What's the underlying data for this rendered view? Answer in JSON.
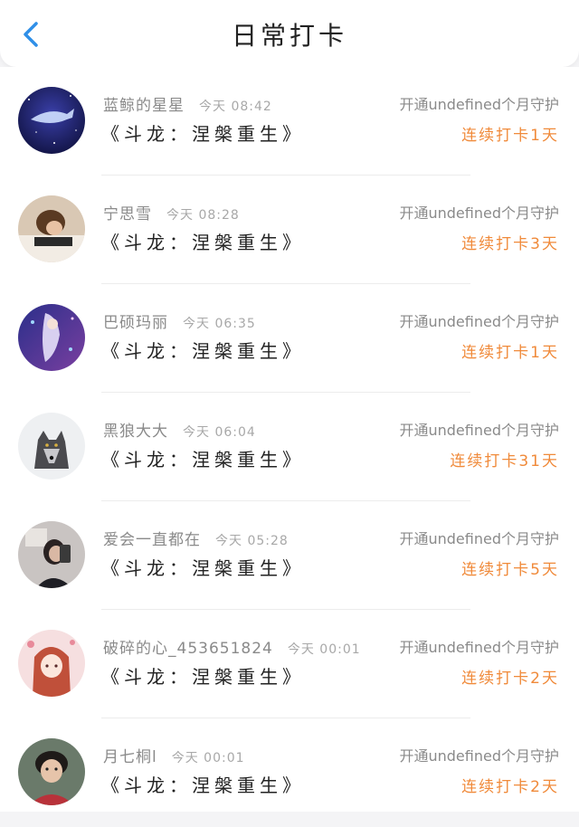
{
  "header": {
    "title": "日常打卡",
    "back_icon": "chevron-left-icon",
    "accent": "#2f8fe8"
  },
  "colors": {
    "streak": "#f08a3a",
    "muted": "#8a8a8a"
  },
  "entries": [
    {
      "username": "蓝鲸的星星",
      "time": "今天 08:42",
      "book": "《斗龙：涅槃重生》",
      "vip": "开通undefined个月守护",
      "streak": "连续打卡1天",
      "avatar": "whale-night-avatar"
    },
    {
      "username": "宁思雪",
      "time": "今天 08:28",
      "book": "《斗龙：涅槃重生》",
      "vip": "开通undefined个月守护",
      "streak": "连续打卡3天",
      "avatar": "girl-studying-avatar"
    },
    {
      "username": "巴硕玛丽",
      "time": "今天 06:35",
      "book": "《斗龙：涅槃重生》",
      "vip": "开通undefined个月守护",
      "streak": "连续打卡1天",
      "avatar": "anime-fantasy-avatar"
    },
    {
      "username": "黑狼大大",
      "time": "今天 06:04",
      "book": "《斗龙：涅槃重生》",
      "vip": "开通undefined个月守护",
      "streak": "连续打卡31天",
      "avatar": "wolf-snow-avatar"
    },
    {
      "username": "爱会一直都在",
      "time": "今天 05:28",
      "book": "《斗龙：涅槃重生》",
      "vip": "开通undefined个月守护",
      "streak": "连续打卡5天",
      "avatar": "mirror-selfie-avatar"
    },
    {
      "username": "破碎的心_453651824",
      "time": "今天 00:01",
      "book": "《斗龙：涅槃重生》",
      "vip": "开通undefined个月守护",
      "streak": "连续打卡2天",
      "avatar": "anime-girl-avatar"
    },
    {
      "username": "月七桐l",
      "time": "今天 00:01",
      "book": "《斗龙：涅槃重生》",
      "vip": "开通undefined个月守护",
      "streak": "连续打卡2天",
      "avatar": "boy-portrait-avatar"
    }
  ]
}
